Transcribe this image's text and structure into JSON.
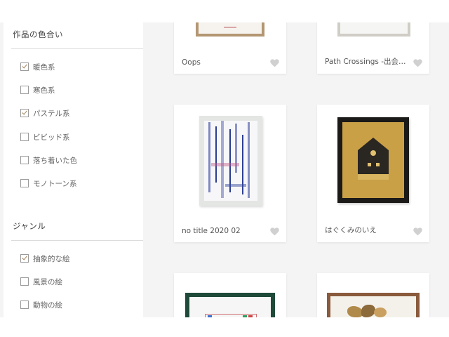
{
  "filters": {
    "color_section": {
      "title": "作品の色合い",
      "options": [
        {
          "label": "暖色系",
          "checked": true
        },
        {
          "label": "寒色系",
          "checked": false
        },
        {
          "label": "パステル系",
          "checked": true
        },
        {
          "label": "ビビッド系",
          "checked": false
        },
        {
          "label": "落ち着いた色",
          "checked": false
        },
        {
          "label": "モノトーン系",
          "checked": false
        }
      ]
    },
    "genre_section": {
      "title": "ジャンル",
      "options": [
        {
          "label": "抽象的な絵",
          "checked": true
        },
        {
          "label": "風景の絵",
          "checked": false
        },
        {
          "label": "動物の絵",
          "checked": false
        }
      ]
    }
  },
  "artworks": [
    {
      "title": "Oops"
    },
    {
      "title": "Path Crossings -出会…"
    },
    {
      "title": "no title 2020 02"
    },
    {
      "title": "はぐくみのいえ"
    },
    {
      "title": ""
    },
    {
      "title": ""
    }
  ],
  "colors": {
    "accent_check": "#a0835a",
    "heart": "#d0d0d0",
    "page_bg": "#f4f4f4"
  }
}
